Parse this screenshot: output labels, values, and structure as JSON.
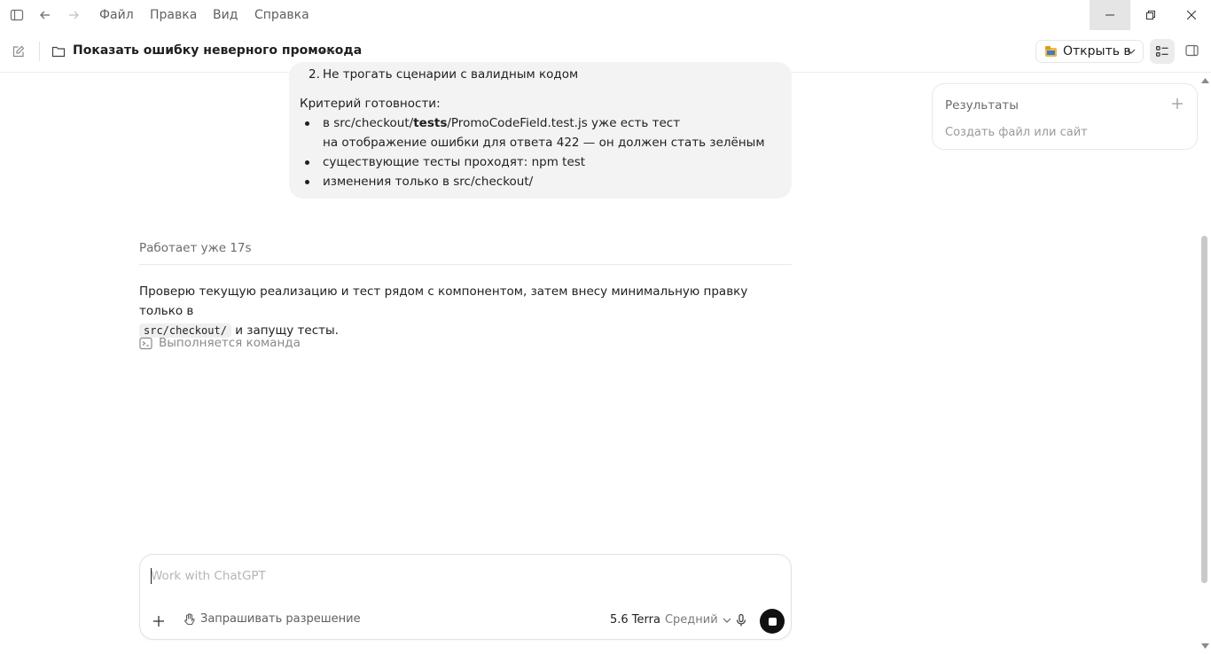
{
  "menu": [
    "Файл",
    "Правка",
    "Вид",
    "Справка"
  ],
  "header": {
    "title": "Показать ошибку неверного промокода",
    "open_in": "Открыть в"
  },
  "message": {
    "item2_number": "2.",
    "item2": "Не трогать сценарии с валидным кодом",
    "criteria_heading": "Критерий готовности:",
    "bullet1_a": "в src/checkout/",
    "bullet1_bold": "tests",
    "bullet1_b": "/PromoCodeField.test.js уже есть тест",
    "bullet1_cont": "на отображение ошибки для ответа 422 — он должен стать зелёным",
    "bullet2": "существующие тесты проходят: npm test",
    "bullet3": "изменения только в src/checkout/"
  },
  "status": "Работает уже 17s",
  "reply": {
    "text1": "Проверю текущую реализацию и тест рядом с компонентом, затем внесу минимальную правку только в",
    "code": "src/checkout/",
    "text2": "и запущу тесты."
  },
  "exec_label": "Выполняется команда",
  "results": {
    "title": "Результаты",
    "subtitle": "Создать файл или сайт"
  },
  "composer": {
    "placeholder": "Work with ChatGPT",
    "permission": "Запрашивать разрешение",
    "model": "5.6 Terra",
    "effort": "Средний"
  },
  "icons": {
    "sidebar": "sidebar-icon",
    "back": "arrow-left-icon",
    "forward": "arrow-right-icon",
    "new_chat": "edit-icon",
    "folder": "folder-icon",
    "more": "ellipsis-icon",
    "terminal": "terminal-icon",
    "plus": "plus-icon",
    "hand": "hand-icon",
    "chevron": "chevron-down-icon",
    "mic": "mic-icon",
    "stop": "stop-icon"
  },
  "colors": {
    "accent": "#111111",
    "bubble": "#f3f3f3",
    "muted": "#6b6b6b"
  }
}
